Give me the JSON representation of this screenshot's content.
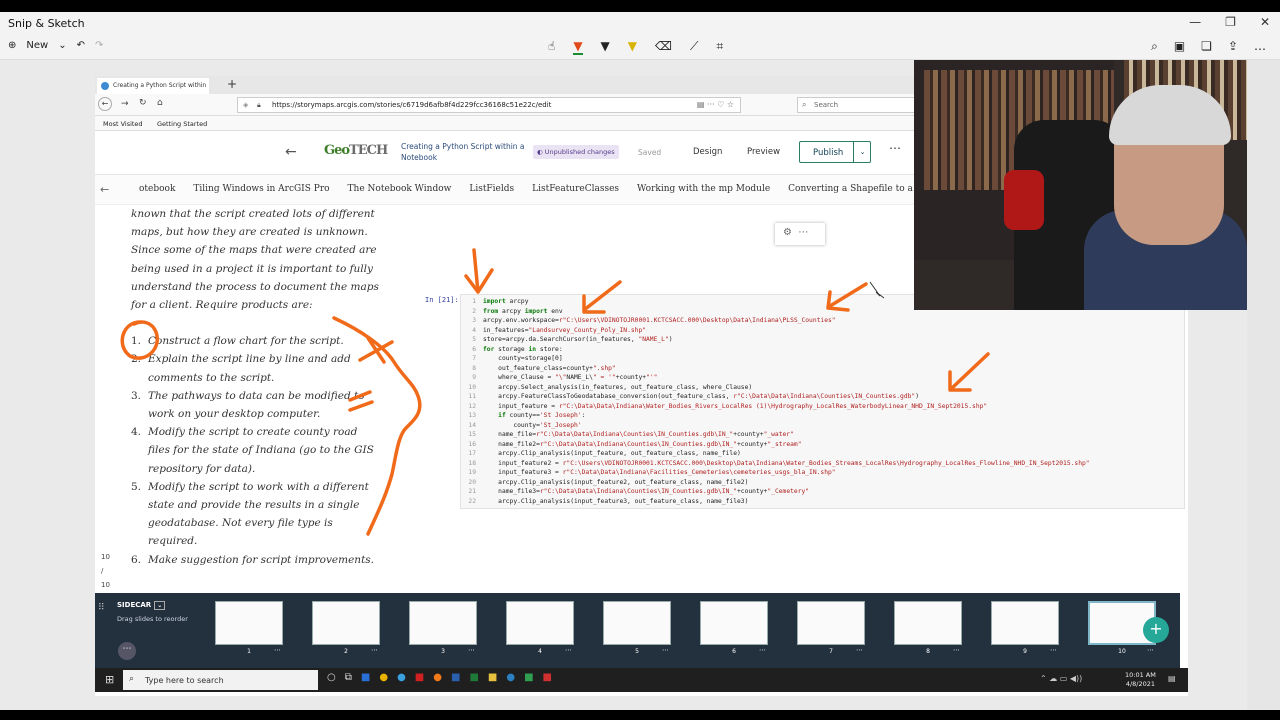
{
  "snip": {
    "title": "Snip & Sketch",
    "new_label": "New"
  },
  "browser": {
    "tab_title": "Creating a Python Script within",
    "url": "https://storymaps.arcgis.com/stories/c6719d6afb8f4d229fcc36168c51e22c/edit",
    "search_placeholder": "Search",
    "bookmarks": [
      "Most Visited",
      "Getting Started"
    ]
  },
  "storymap": {
    "logo_geo": "GeoTECH",
    "doc_title": "Creating a Python Script within a Notebook",
    "status_badge": "Unpublished changes",
    "saved": "Saved",
    "design": "Design",
    "preview": "Preview",
    "publish": "Publish",
    "nav_items": [
      "otebook",
      "Tiling Windows in ArcGIS Pro",
      "The Notebook Window",
      "ListFields",
      "ListFeatureClasses",
      "Working with the mp Module",
      "Converting a Shapefile to a Fe..."
    ]
  },
  "story": {
    "intro": "known that the script created lots of different maps, but how they are created is unknown. Since some of the maps that were created are being used in a project it is important to fully understand the process to document the maps for a client. Require products are:",
    "items": [
      {
        "num": "1.",
        "text": "Construct a flow chart for the script."
      },
      {
        "num": "2.",
        "text": "Explain the script line by line and add comments to the script."
      },
      {
        "num": "3.",
        "text": "The pathways to data can be modified to work on your desktop computer."
      },
      {
        "num": "4.",
        "text": "Modify the script to create county road files for the state of Indiana (go to the GIS repository for data)."
      },
      {
        "num": "5.",
        "text": "Modify the script to work with a different state and provide the results in a single geodatabase. Not every file type is required."
      },
      {
        "num": "6.",
        "text": "Make suggestion for script improvements."
      }
    ],
    "left_markers": [
      "10",
      "/",
      "10"
    ]
  },
  "notebook": {
    "in_label": "In [21]:",
    "line_numbers": "1\n2\n3\n4\n5\n6\n7\n8\n9\n10\n11\n12\n13\n14\n15\n16\n17\n18\n19\n20\n21\n22",
    "code": [
      "import arcpy",
      "from arcpy import env",
      "arcpy.env.workspace=r\"C:\\Users\\VDINOTOJR0001.KCTCSACC.000\\Desktop\\Data\\Indiana\\PLSS_Counties\"",
      "in_features=\"Landsurvey_County_Poly_IN.shp\"",
      "store=arcpy.da.SearchCursor(in_features, \"NAME_L\")",
      "for storage in store:",
      "    county=storage[0]",
      "    out_feature_class=county+\".shp\"",
      "    where_Clause = \"\\\"NAME_L\\\" = '\"+county+\"'\"",
      "    arcpy.Select_analysis(in_features, out_feature_class, where_Clause)",
      "    arcpy.FeatureClassToGeodatabase_conversion(out_feature_class, r\"C:\\Data\\Data\\Indiana\\Counties\\IN_Counties.gdb\")",
      "    input_feature = r\"C:\\Data\\Data\\Indiana\\Water_Bodies_Rivers_LocalRes (1)\\Hydrography_LocalRes_WaterbodyLinear_NHD_IN_Sept2015.shp\"",
      "    if county=='St Joseph':",
      "        county='St_Joseph'",
      "    name_file=r\"C:\\Data\\Data\\Indiana\\Counties\\IN_Counties.gdb\\IN_\"+county+\"_water\"",
      "    name_file2=r\"C:\\Data\\Data\\Indiana\\Counties\\IN_Counties.gdb\\IN_\"+county+\"_stream\"",
      "    arcpy.Clip_analysis(input_feature, out_feature_class, name_file)",
      "    input_feature2 = r\"C:\\Users\\VDINOTOJR0001.KCTCSACC.000\\Desktop\\Data\\Indiana\\Water_Bodies_Streams_LocalRes\\Hydrography_LocalRes_Flowline_NHD_IN_Sept2015.shp\"",
      "    input_feature3 = r\"C:\\Data\\Data\\Indiana\\Facilities_Cemeteries\\cemeteries_usgs_bla_IN.shp\"",
      "    arcpy.Clip_analysis(input_feature2, out_feature_class, name_file2)",
      "    name_file3=r\"C:\\Data\\Data\\Indiana\\Counties\\IN_Counties.gdb\\IN_\"+county+\"_Cemetery\"",
      "    arcpy.Clip_analysis(input_feature3, out_feature_class, name_file3)"
    ]
  },
  "sidecar": {
    "title": "SIDECAR",
    "subtitle": "Drag slides to reorder",
    "slides": [
      "1",
      "2",
      "3",
      "4",
      "5",
      "6",
      "7",
      "8",
      "9",
      "10"
    ],
    "add": "+"
  },
  "taskbar": {
    "search_placeholder": "Type here to search",
    "time": "10:01 AM",
    "date": "4/8/2021"
  },
  "colors": {
    "ink": "#f06a1a",
    "sidecar_bg": "#23303e",
    "add_button": "#25a898",
    "publish_border": "#2a7f62"
  }
}
